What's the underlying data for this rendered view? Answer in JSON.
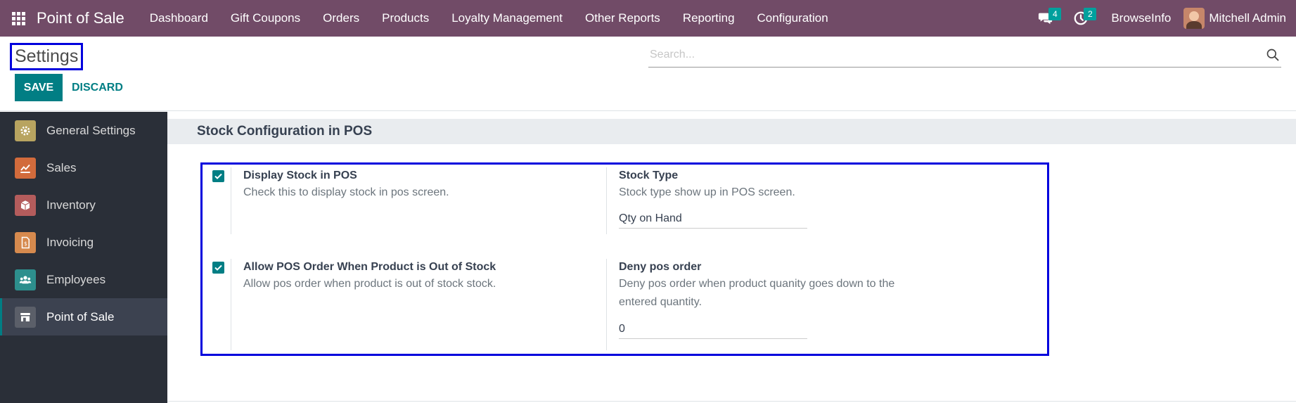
{
  "navbar": {
    "brand": "Point of Sale",
    "menu": [
      "Dashboard",
      "Gift Coupons",
      "Orders",
      "Products",
      "Loyalty Management",
      "Other Reports",
      "Reporting",
      "Configuration"
    ],
    "messages_count": "4",
    "activities_count": "2",
    "company": "BrowseInfo",
    "user": "Mitchell Admin"
  },
  "control": {
    "title": "Settings",
    "search_placeholder": "Search...",
    "save_label": "SAVE",
    "discard_label": "DISCARD"
  },
  "sidebar": {
    "items": [
      {
        "label": "General Settings",
        "icon": "gear-icon",
        "color": "#b8a460"
      },
      {
        "label": "Sales",
        "icon": "chart-line-icon",
        "color": "#d26b3c"
      },
      {
        "label": "Inventory",
        "icon": "box-icon",
        "color": "#b45c5c"
      },
      {
        "label": "Invoicing",
        "icon": "invoice-dollar-icon",
        "color": "#d68a4e"
      },
      {
        "label": "Employees",
        "icon": "users-icon",
        "color": "#2d8f8d"
      },
      {
        "label": "Point of Sale",
        "icon": "store-icon",
        "color": "#5b5f69"
      }
    ],
    "active": "Point of Sale"
  },
  "content": {
    "section_title": "Stock Configuration in POS",
    "settings": [
      {
        "label": "Display Stock in POS",
        "description": "Check this to display stock in pos screen.",
        "checked": true,
        "right_label": "Stock Type",
        "right_description": "Stock type show up in POS screen.",
        "right_value": "Qty on Hand"
      },
      {
        "label": "Allow POS Order When Product is Out of Stock",
        "description": "Allow pos order when product is out of stock stock.",
        "checked": true,
        "right_label": "Deny pos order",
        "right_description": "Deny pos order when product quanity goes down to the entered quantity.",
        "right_value": "0"
      }
    ]
  },
  "colors": {
    "navbar": "#714b67",
    "primary": "#017e84",
    "highlight": "#0000dd",
    "sidebar": "#2a2f38"
  }
}
